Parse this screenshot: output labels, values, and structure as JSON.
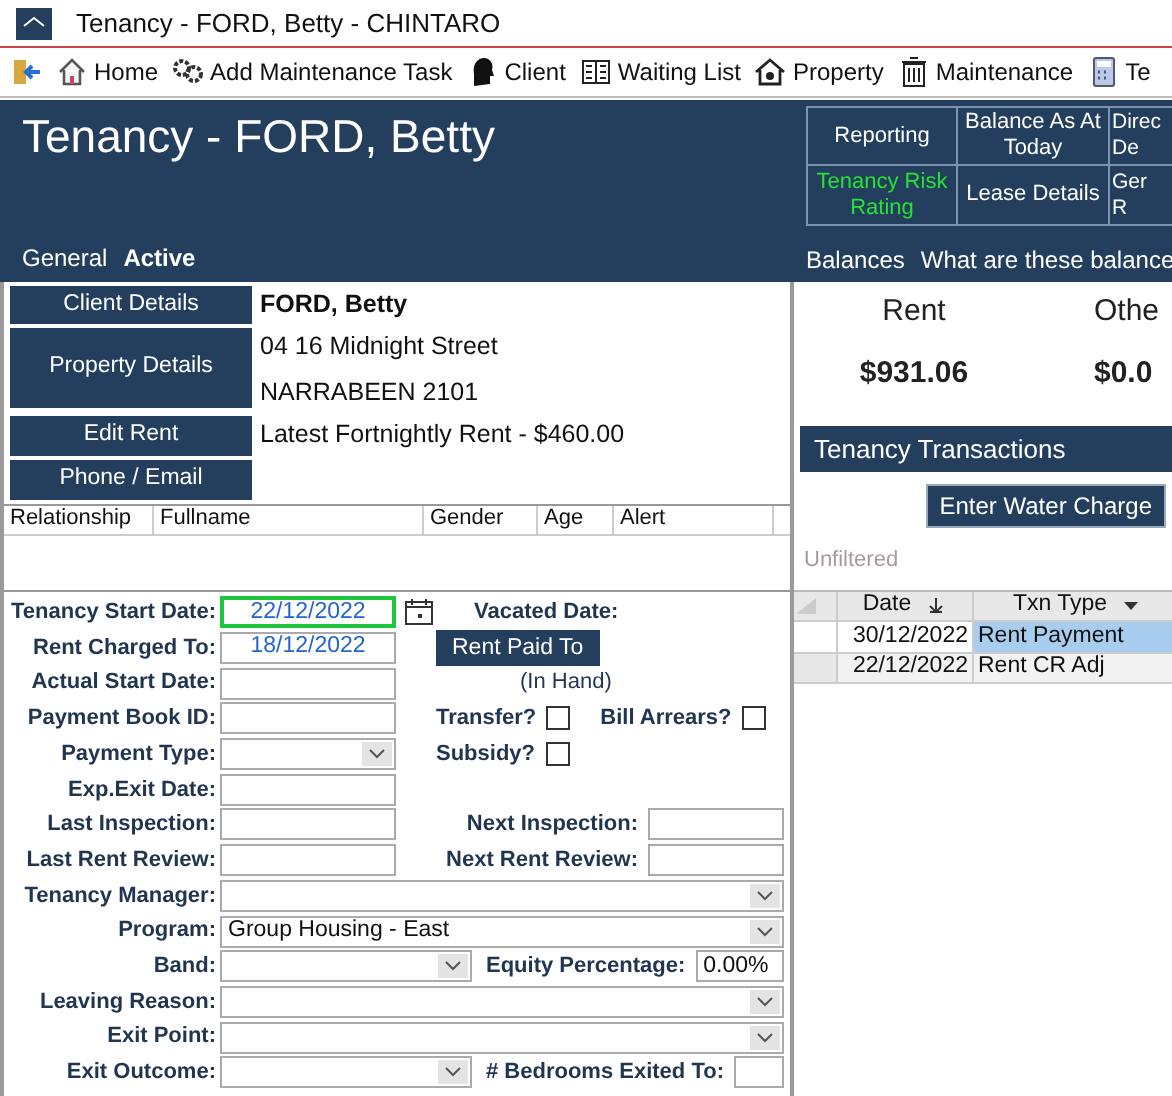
{
  "window": {
    "title": "Tenancy - FORD, Betty - CHINTARO"
  },
  "toolbar": [
    {
      "kind": "exit"
    },
    {
      "kind": "home",
      "label": "Home"
    },
    {
      "kind": "gears",
      "label": "Add Maintenance Task"
    },
    {
      "kind": "client",
      "label": "Client"
    },
    {
      "kind": "list",
      "label": "Waiting List"
    },
    {
      "kind": "property",
      "label": "Property"
    },
    {
      "kind": "trash",
      "label": "Maintenance"
    },
    {
      "kind": "calculator",
      "label": "Te"
    }
  ],
  "header": {
    "title": "Tenancy - FORD, Betty",
    "section": "General",
    "status": "Active",
    "nav": [
      [
        {
          "label": "Reporting",
          "highlighted": false
        },
        {
          "label": "Balance As At\nToday",
          "highlighted": false
        },
        {
          "label": "Direc\nDe",
          "highlighted": false
        }
      ],
      [
        {
          "label": "Tenancy Risk\nRating",
          "highlighted": true
        },
        {
          "label": "Lease Details",
          "highlighted": false
        },
        {
          "label": "Ger\nR",
          "highlighted": false
        }
      ]
    ],
    "balances_label": "Balances",
    "balances_link": "What are these balance"
  },
  "client": [
    {
      "button": "Client Details",
      "kind": "name",
      "lines": [
        "FORD, Betty"
      ]
    },
    {
      "button": "Property Details",
      "kind": "address",
      "lines": [
        "04 16 Midnight Street",
        "NARRABEEN 2101"
      ]
    },
    {
      "button": "Edit Rent",
      "kind": "address",
      "lines": [
        "Latest Fortnightly Rent - $460.00"
      ]
    },
    {
      "button": "Phone / Email",
      "kind": "address"
    }
  ],
  "household": {
    "columns": [
      "Relationship",
      "Fullname",
      "Gender",
      "Age",
      "Alert"
    ]
  },
  "form": [
    {
      "label": "Tenancy Start Date:",
      "field": {
        "kind": "date",
        "value": "22/12/2022",
        "highlighted": true
      },
      "right": [
        {
          "kind": "label",
          "text": "Vacated Date:"
        }
      ]
    },
    {
      "label": "Rent Charged To:",
      "field": {
        "kind": "date",
        "value": "18/12/2022",
        "highlighted": false
      },
      "right": [
        {
          "kind": "button",
          "text": "Rent Paid To"
        }
      ]
    },
    {
      "label": "Actual Start Date:",
      "field": {
        "kind": "text"
      },
      "right": [
        {
          "kind": "note",
          "text": "(In Hand)"
        }
      ]
    },
    {
      "label": "Payment Book ID:",
      "field": {
        "kind": "text"
      },
      "right": [
        {
          "kind": "checkbox",
          "text": "Transfer?",
          "checked": false
        },
        {
          "kind": "checkbox",
          "text": "Bill Arrears?",
          "checked": false
        }
      ]
    },
    {
      "label": "Payment Type:",
      "field": {
        "kind": "select"
      },
      "right": [
        {
          "kind": "checkbox",
          "text": "Subsidy?",
          "checked": false
        }
      ]
    },
    {
      "label": "Exp.Exit Date:",
      "field": {
        "kind": "text"
      }
    },
    {
      "label": "Last Inspection:",
      "field": {
        "kind": "text"
      },
      "right": [
        {
          "kind": "label",
          "text": "Next Inspection:"
        },
        {
          "kind": "text"
        }
      ]
    },
    {
      "label": "Last Rent Review:",
      "field": {
        "kind": "text"
      },
      "right": [
        {
          "kind": "label",
          "text": "Next Rent Review:"
        },
        {
          "kind": "text"
        }
      ]
    },
    {
      "label": "Tenancy Manager:",
      "field": {
        "kind": "select"
      }
    },
    {
      "label": "Program:",
      "field": {
        "kind": "select",
        "value": "Group Housing - East"
      }
    },
    {
      "label": "Band:",
      "field": {
        "kind": "select"
      },
      "right": [
        {
          "kind": "label",
          "text": "Equity Percentage:"
        },
        {
          "kind": "text",
          "value": "0.00%"
        }
      ]
    },
    {
      "label": "Leaving Reason:",
      "field": {
        "kind": "select"
      }
    },
    {
      "label": "Exit Point:",
      "field": {
        "kind": "select"
      }
    },
    {
      "label": "Exit Outcome:",
      "field": {
        "kind": "select"
      },
      "right": [
        {
          "kind": "label",
          "text": "# Bedrooms Exited To:"
        },
        {
          "kind": "text"
        }
      ]
    }
  ],
  "balances": [
    {
      "label": "Rent",
      "amount": "$931.06"
    },
    {
      "label": "Othe",
      "amount": "$0.0"
    }
  ],
  "transactions": {
    "title": "Tenancy Transactions",
    "button": "Enter Water Charge",
    "filter": "Unfiltered",
    "columns": [
      "Date",
      "Txn Type"
    ],
    "rows": [
      {
        "cells": [
          "30/12/2022",
          "Rent Payment"
        ],
        "selected": true
      },
      {
        "cells": [
          "22/12/2022",
          "Rent CR Adj"
        ],
        "selected": false
      }
    ]
  }
}
